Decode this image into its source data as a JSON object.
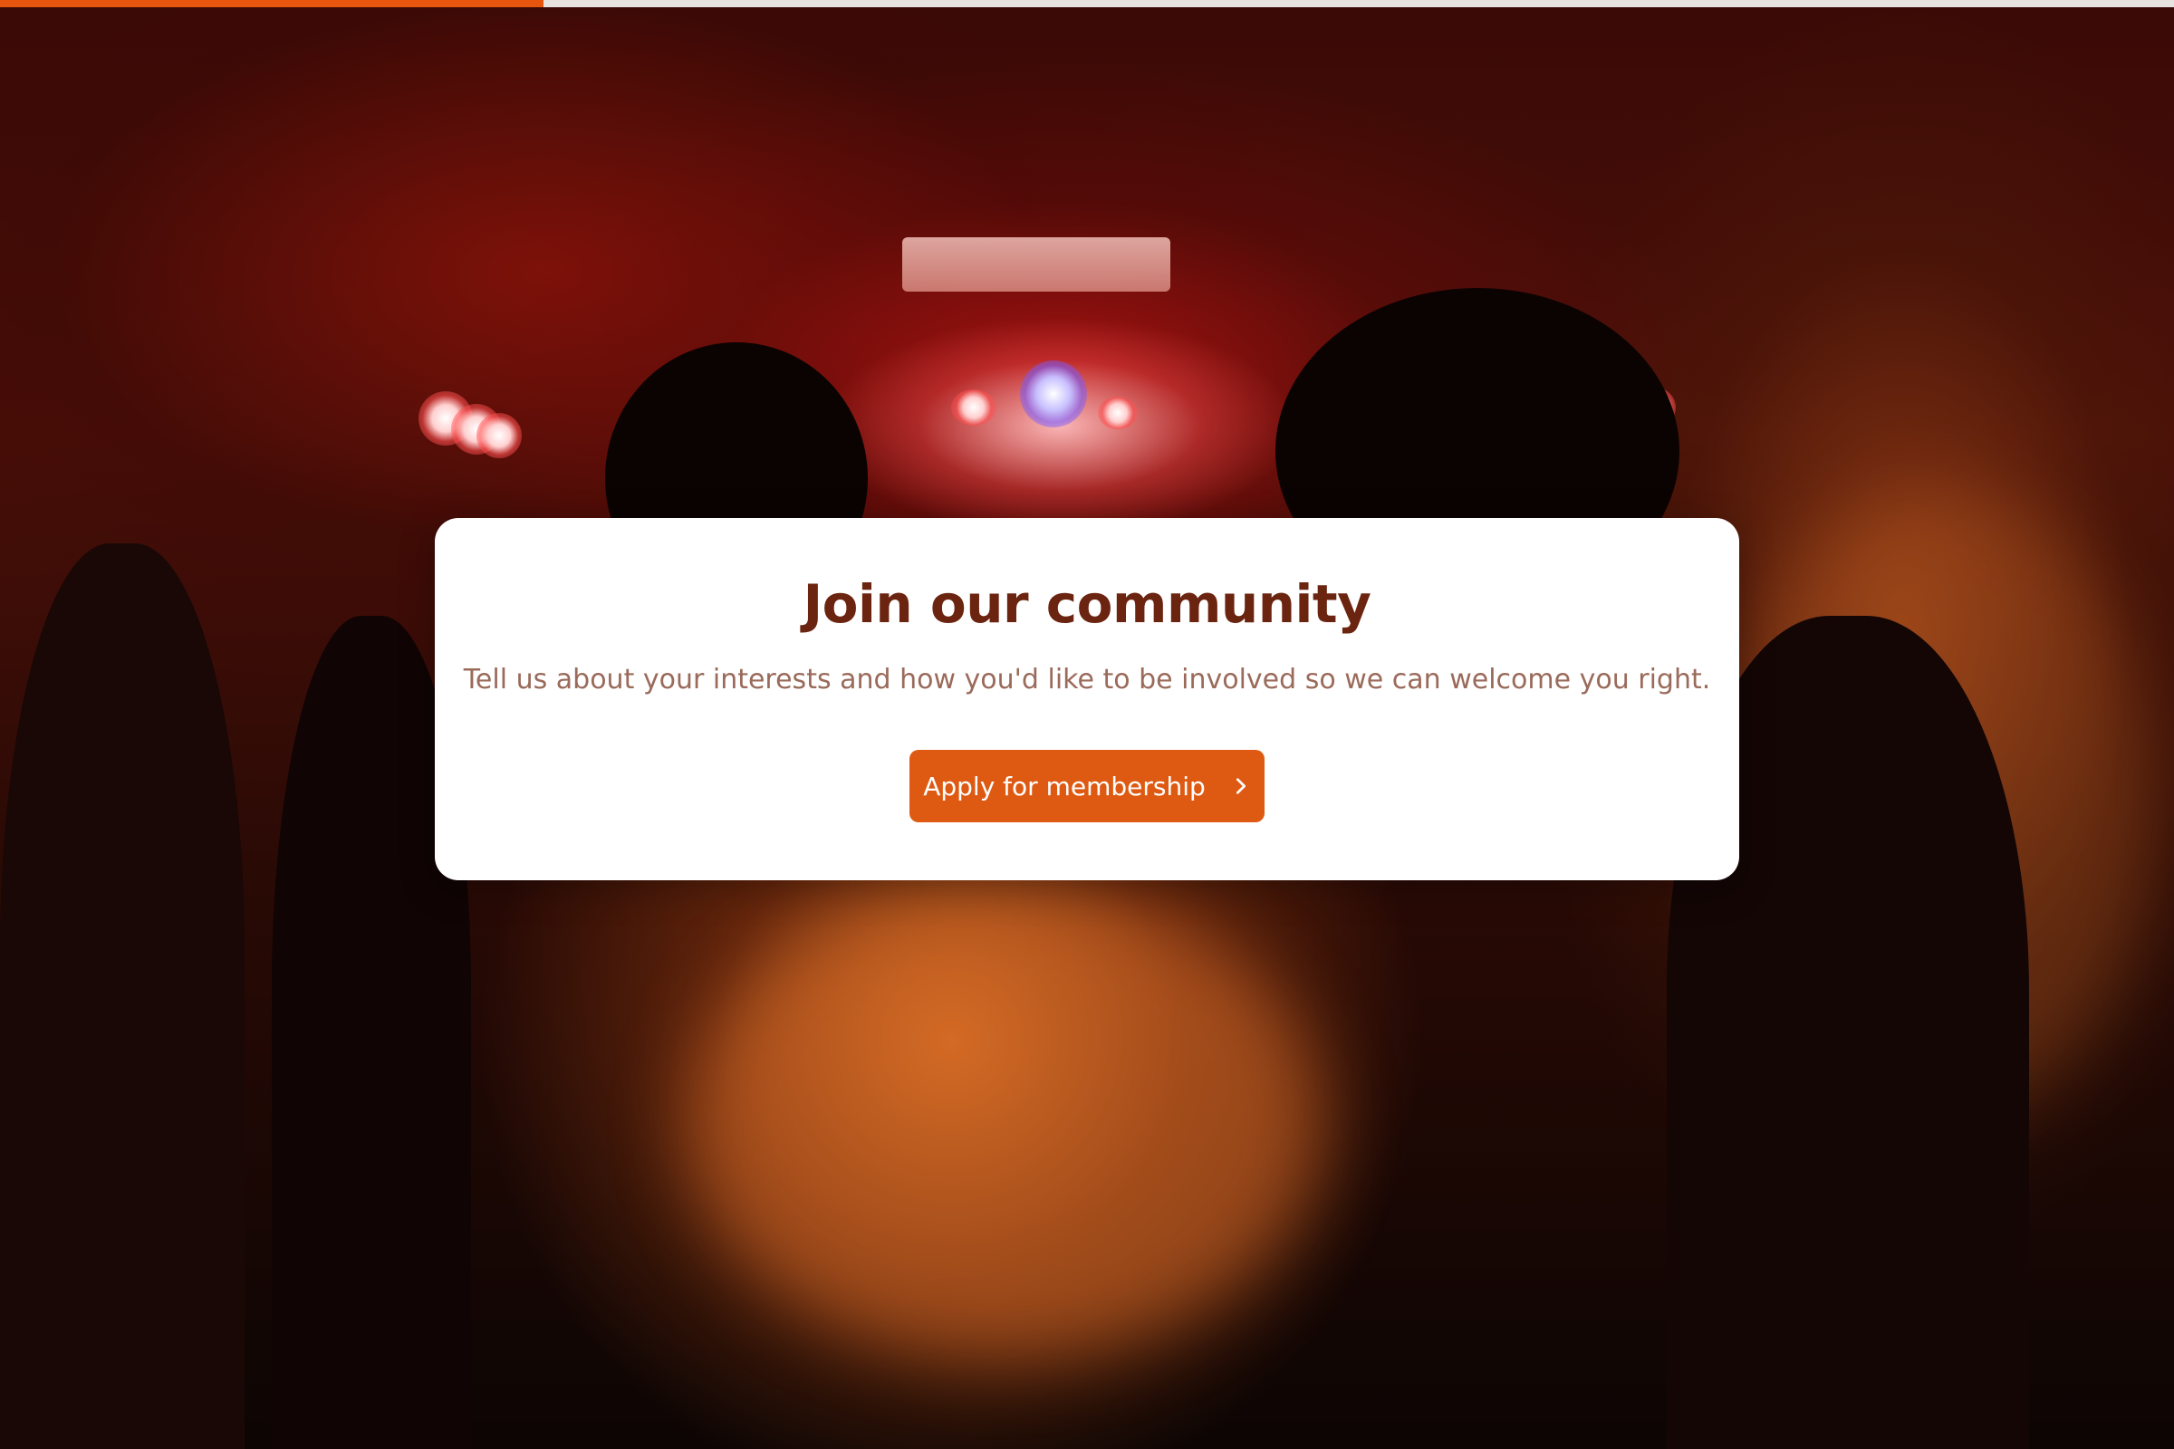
{
  "progress": {
    "percent": 25
  },
  "card": {
    "title": "Join our community",
    "subtitle": "Tell us about your interests and how you'd like to be involved so we can welcome you right.",
    "button_label": "Apply for membership",
    "button_icon": "chevron-right-icon"
  },
  "colors": {
    "accent": "#de5a12",
    "title": "#6b2410",
    "subtitle": "#9a6a5a",
    "progress_track": "#e7e3e1"
  }
}
